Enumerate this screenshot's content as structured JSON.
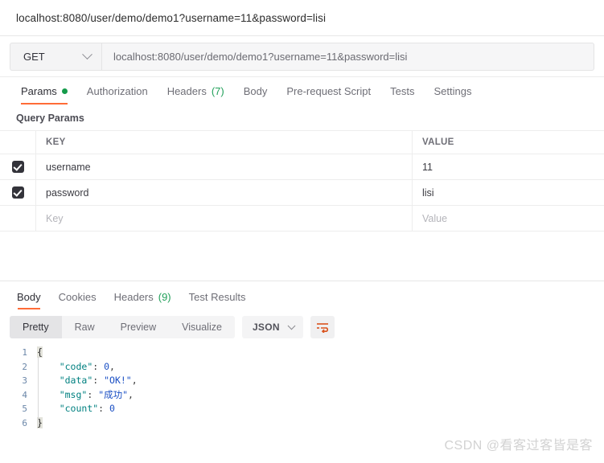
{
  "titlebar": {
    "url": "localhost:8080/user/demo/demo1?username=11&password=lisi"
  },
  "request": {
    "method": "GET",
    "url_value": "localhost:8080/user/demo/demo1?username=11&password=lisi",
    "tabs": [
      {
        "label": "Params",
        "badge": "",
        "dot": true,
        "active": true
      },
      {
        "label": "Authorization",
        "badge": "",
        "dot": false,
        "active": false
      },
      {
        "label": "Headers",
        "badge": "(7)",
        "dot": false,
        "active": false
      },
      {
        "label": "Body",
        "badge": "",
        "dot": false,
        "active": false
      },
      {
        "label": "Pre-request Script",
        "badge": "",
        "dot": false,
        "active": false
      },
      {
        "label": "Tests",
        "badge": "",
        "dot": false,
        "active": false
      },
      {
        "label": "Settings",
        "badge": "",
        "dot": false,
        "active": false
      }
    ]
  },
  "query_params": {
    "section_title": "Query Params",
    "columns": {
      "key": "KEY",
      "value": "VALUE"
    },
    "rows": [
      {
        "checked": true,
        "key": "username",
        "value": "11"
      },
      {
        "checked": true,
        "key": "password",
        "value": "lisi"
      }
    ],
    "placeholder_row": {
      "key": "Key",
      "value": "Value"
    }
  },
  "response": {
    "tabs": [
      {
        "label": "Body",
        "badge": "",
        "active": true
      },
      {
        "label": "Cookies",
        "badge": "",
        "active": false
      },
      {
        "label": "Headers",
        "badge": "(9)",
        "active": false
      },
      {
        "label": "Test Results",
        "badge": "",
        "active": false
      }
    ],
    "view_modes": [
      {
        "label": "Pretty",
        "active": true
      },
      {
        "label": "Raw",
        "active": false
      },
      {
        "label": "Preview",
        "active": false
      },
      {
        "label": "Visualize",
        "active": false
      }
    ],
    "format": "JSON",
    "body_lines": [
      {
        "n": "1",
        "segments": [
          {
            "t": "{",
            "c": "brace-hl"
          }
        ]
      },
      {
        "n": "2",
        "segments": [
          {
            "t": "    ",
            "c": "k-pun"
          },
          {
            "t": "\"code\"",
            "c": "k-key"
          },
          {
            "t": ": ",
            "c": "k-pun"
          },
          {
            "t": "0",
            "c": "k-num"
          },
          {
            "t": ",",
            "c": "k-pun"
          }
        ]
      },
      {
        "n": "3",
        "segments": [
          {
            "t": "    ",
            "c": "k-pun"
          },
          {
            "t": "\"data\"",
            "c": "k-key"
          },
          {
            "t": ": ",
            "c": "k-pun"
          },
          {
            "t": "\"OK!\"",
            "c": "k-str"
          },
          {
            "t": ",",
            "c": "k-pun"
          }
        ]
      },
      {
        "n": "4",
        "segments": [
          {
            "t": "    ",
            "c": "k-pun"
          },
          {
            "t": "\"msg\"",
            "c": "k-key"
          },
          {
            "t": ": ",
            "c": "k-pun"
          },
          {
            "t": "\"成功\"",
            "c": "k-str"
          },
          {
            "t": ",",
            "c": "k-pun"
          }
        ]
      },
      {
        "n": "5",
        "segments": [
          {
            "t": "    ",
            "c": "k-pun"
          },
          {
            "t": "\"count\"",
            "c": "k-key"
          },
          {
            "t": ": ",
            "c": "k-pun"
          },
          {
            "t": "0",
            "c": "k-num"
          }
        ]
      },
      {
        "n": "6",
        "segments": [
          {
            "t": "}",
            "c": "brace-hl"
          }
        ]
      }
    ]
  },
  "watermark": "CSDN @看客过客皆是客",
  "colors": {
    "accent_orange": "#ff6c37",
    "badge_green": "#21a05a",
    "dot_green": "#159b4b",
    "json_key": "#008080",
    "json_string": "#1a4fc4"
  }
}
